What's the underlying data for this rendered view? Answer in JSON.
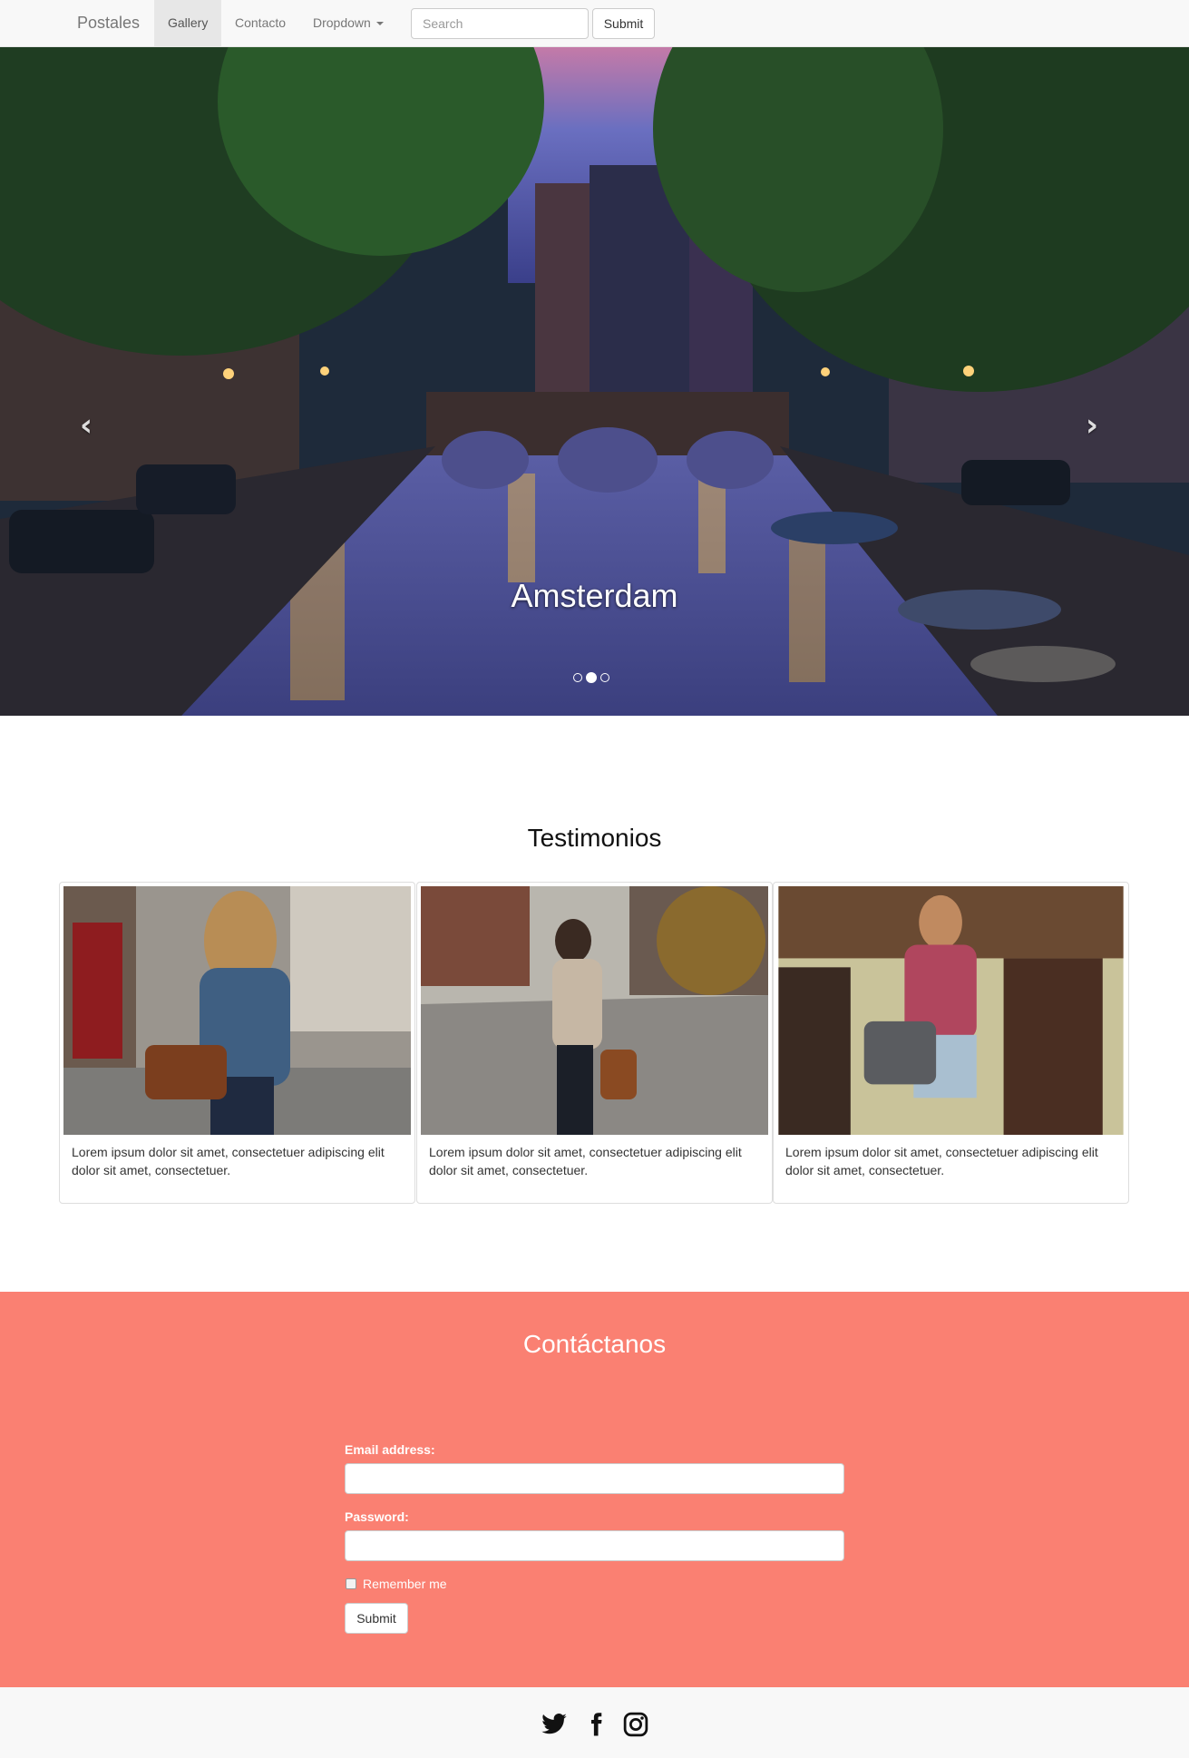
{
  "navbar": {
    "brand": "Postales",
    "items": [
      {
        "label": "Gallery",
        "active": true
      },
      {
        "label": "Contacto",
        "active": false
      },
      {
        "label": "Dropdown",
        "active": false
      }
    ],
    "search": {
      "placeholder": "Search",
      "value": ""
    },
    "submit_label": "Submit"
  },
  "carousel": {
    "caption": "Amsterdam",
    "prev_icon": "chevron-left-icon",
    "next_icon": "chevron-right-icon",
    "slide_count": 3,
    "active_index": 1
  },
  "testimonials": {
    "title": "Testimonios",
    "items": [
      {
        "image": "woman-with-leather-bag-photo",
        "text": "Lorem ipsum dolor sit amet, consectetuer adipiscing elit dolor sit amet, consectetuer."
      },
      {
        "image": "woman-with-camera-photo",
        "text": "Lorem ipsum dolor sit amet, consectetuer adipiscing elit dolor sit amet, consectetuer."
      },
      {
        "image": "man-with-camera-photo",
        "text": "Lorem ipsum dolor sit amet, consectetuer adipiscing elit dolor sit amet, consectetuer."
      }
    ]
  },
  "contact": {
    "title": "Contáctanos",
    "email_label": "Email address:",
    "email_value": "",
    "password_label": "Password:",
    "password_value": "",
    "remember_label": "Remember me",
    "remember_checked": false,
    "submit_label": "Submit",
    "background": "#fa8072"
  },
  "footer": {
    "icons": [
      "twitter-icon",
      "facebook-icon",
      "instagram-icon"
    ]
  }
}
